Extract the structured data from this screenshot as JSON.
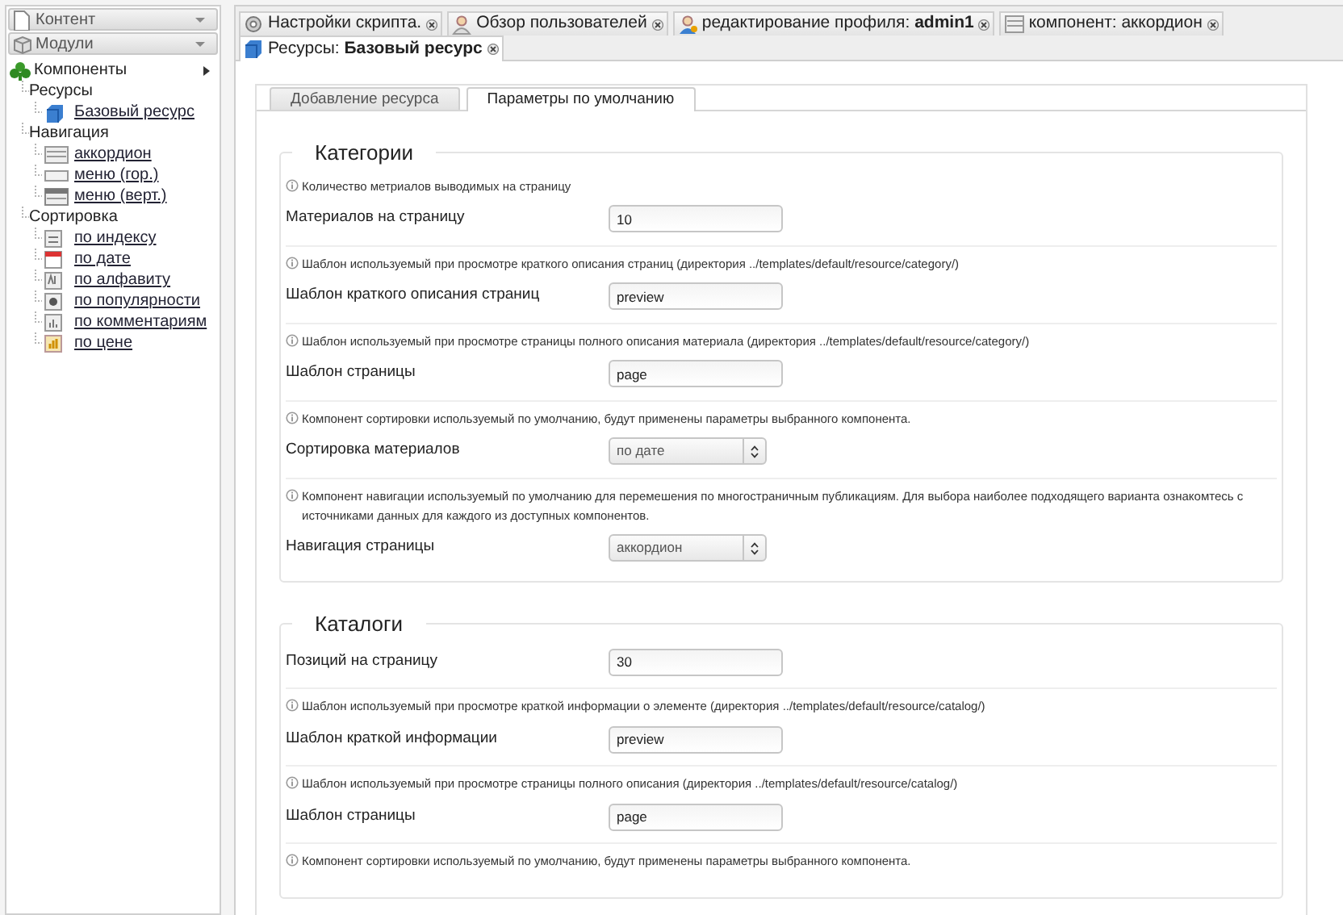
{
  "sidebar": {
    "panels": [
      {
        "title": "Контент"
      },
      {
        "title": "Модули"
      }
    ],
    "tree": {
      "label": "Компоненты",
      "children": [
        {
          "label": "Ресурсы",
          "children": [
            {
              "label": "Базовый ресурс"
            }
          ]
        },
        {
          "label": "Навигация",
          "children": [
            {
              "label": "аккордион"
            },
            {
              "label": "меню (гор.)"
            },
            {
              "label": "меню (верт.)"
            }
          ]
        },
        {
          "label": "Сортировка",
          "children": [
            {
              "label": "по индексу"
            },
            {
              "label": "по дате"
            },
            {
              "label": "по алфавиту"
            },
            {
              "label": "по популярности"
            },
            {
              "label": "по комментариям"
            },
            {
              "label": "по цене"
            }
          ]
        }
      ]
    }
  },
  "tabs": [
    {
      "label": "Настройки скрипта.",
      "selected": false
    },
    {
      "label": "Обзор пользователей",
      "selected": false
    },
    {
      "label": "редактирование профиля: **admin1**",
      "selected": false
    },
    {
      "label": "компонент: аккордион",
      "selected": false
    },
    {
      "label": "Ресурсы: **Базовый ресурс**",
      "selected": true
    }
  ],
  "subtabs": [
    {
      "label": "Добавление ресурса",
      "selected": false
    },
    {
      "label": "Параметры по умолчанию",
      "selected": true
    }
  ],
  "sections": [
    {
      "title": "Категории",
      "fields": [
        {
          "hint": "Количество метриалов выводимых на страницу",
          "label": "Материалов на страницу",
          "kind": "text",
          "value": "10"
        },
        {
          "hint": "Шаблон используемый при просмотре краткого описания страниц (директория ../templates/default/resource/category/)",
          "label": "Шаблон краткого описания страниц",
          "kind": "text",
          "value": "preview"
        },
        {
          "hint": "Шаблон используемый при просмотре страницы полного описания материала (директория ../templates/default/resource/category/)",
          "label": "Шаблон страницы",
          "kind": "text",
          "value": "page"
        },
        {
          "hint": "Компонент сортировки используемый по умолчанию, будут применены параметры выбранного компонента.",
          "label": "Сортировка материалов",
          "kind": "select",
          "value": "по дате"
        },
        {
          "hint": "Компонент навигации используемый по умолчанию для перемешения по многостраничным публикациям. Для выбора наиболее подходящего варианта ознакомтесь с источниками данных для каждого из доступных компонентов.",
          "label": "Навигация страницы",
          "kind": "select",
          "value": "аккордион"
        }
      ]
    },
    {
      "title": "Каталоги",
      "fields": [
        {
          "label": "Позиций на страницу",
          "kind": "text",
          "value": "30"
        },
        {
          "hint": "Шаблон используемый при просмотре краткой информации о элементе (директория ../templates/default/resource/catalog/)",
          "label": "Шаблон краткой информации",
          "kind": "text",
          "value": "preview"
        },
        {
          "hint": "Шаблон используемый при просмотре страницы полного описания (директория ../templates/default/resource/catalog/)",
          "label": "Шаблон страницы",
          "kind": "text",
          "value": "page"
        },
        {
          "hint": "Компонент сортировки используемый по умолчанию, будут применены параметры выбранного компонента."
        }
      ]
    }
  ]
}
